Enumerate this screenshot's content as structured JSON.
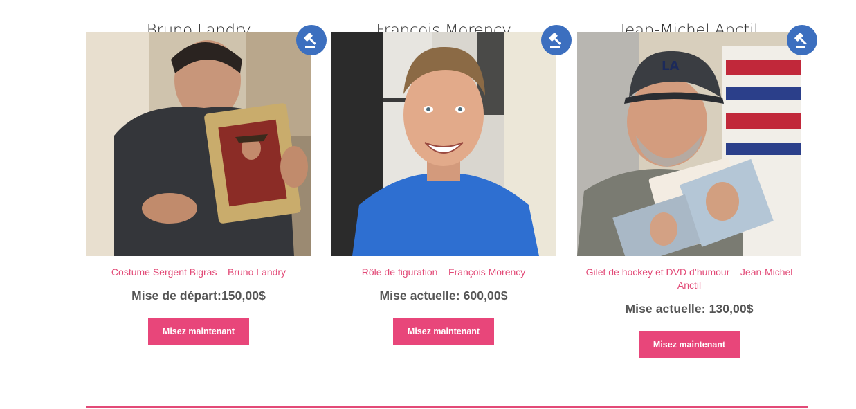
{
  "colors": {
    "accent": "#e8467a",
    "link": "#e24a77",
    "badge": "#3c6fbf",
    "price_text": "#555555",
    "title_text": "#2f2f2f"
  },
  "products": [
    {
      "name": "Bruno Landry",
      "link_text": "Costume Sergent Bigras – Bruno Landry",
      "price_text": "Mise de départ:150,00$",
      "button_label": "Misez maintenant",
      "badge_icon": "auction-gavel-icon"
    },
    {
      "name": "François Morency",
      "link_text": "Rôle de figuration – François Morency",
      "price_text": "Mise actuelle: 600,00$",
      "button_label": "Misez maintenant",
      "badge_icon": "auction-gavel-icon"
    },
    {
      "name": "Jean-Michel Anctil",
      "link_text": "Gilet de hockey et DVD d’humour – Jean-Michel Anctil",
      "price_text": "Mise actuelle: 130,00$",
      "button_label": "Misez maintenant",
      "badge_icon": "auction-gavel-icon"
    }
  ]
}
